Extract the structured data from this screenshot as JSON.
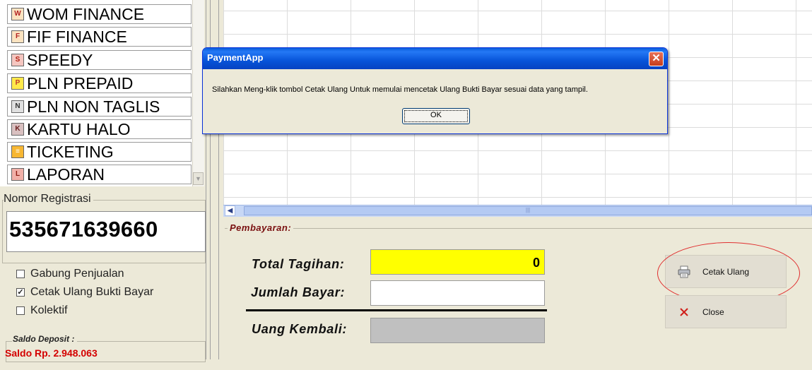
{
  "menu": {
    "items": [
      {
        "label": "WOM FINANCE",
        "icon": "wom-finance-icon",
        "color": "#b22222",
        "glyph": "W"
      },
      {
        "label": "FIF FINANCE",
        "icon": "fif-finance-icon",
        "color": "#b22222",
        "glyph": "F"
      },
      {
        "label": "SPEEDY",
        "icon": "speedy-icon",
        "color": "#d03a2a",
        "glyph": "S"
      },
      {
        "label": "PLN PREPAID",
        "icon": "pln-prepaid-icon",
        "color": "#f1c40f",
        "glyph": "P"
      },
      {
        "label": "PLN NON TAGLIS",
        "icon": "pln-non-taglis-icon",
        "color": "#6d6d6d",
        "glyph": "N"
      },
      {
        "label": "KARTU HALO",
        "icon": "kartu-halo-icon",
        "color": "#8b3a3a",
        "glyph": "K"
      },
      {
        "label": "TICKETING",
        "icon": "ticketing-icon",
        "color": "#f39c12",
        "glyph": "≡"
      },
      {
        "label": "LAPORAN",
        "icon": "laporan-icon",
        "color": "#c0392b",
        "glyph": "L"
      }
    ]
  },
  "registration": {
    "legend": "Nomor Registrasi",
    "number": "535671639660"
  },
  "options": [
    {
      "label": "Gabung Penjualan",
      "checked": false
    },
    {
      "label": "Cetak Ulang Bukti Bayar",
      "checked": true
    },
    {
      "label": "Kolektif",
      "checked": false
    }
  ],
  "saldo": {
    "legend": "Saldo Deposit :",
    "value": "Saldo Rp. 2.948.063"
  },
  "payment": {
    "legend": "Pembayaran:",
    "total_label": "Total Tagihan:",
    "total_value": "0",
    "jumlah_label": "Jumlah Bayar:",
    "jumlah_value": "",
    "kembali_label": "Uang Kembali:",
    "kembali_value": ""
  },
  "buttons": {
    "cetak_label": "Cetak Ulang",
    "close_label": "Close"
  },
  "dialog": {
    "title": "PaymentApp",
    "message": "Silahkan Meng-klik tombol Cetak Ulang Untuk memulai mencetak Ulang Bukti Bayar sesuai data yang tampil.",
    "ok_label": "OK",
    "close_glyph": "✕"
  },
  "colors": {
    "total_bg": "#ffff00",
    "saldo_text": "#d40000",
    "dialog_title": "#0754d9",
    "highlight_ring": "#e03030"
  }
}
